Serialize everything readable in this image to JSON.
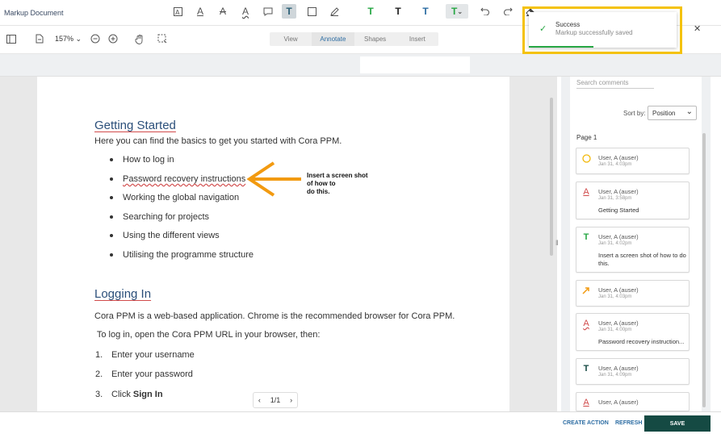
{
  "app": {
    "title": "Markup Document"
  },
  "toolbar": {
    "zoom": "157%",
    "modes": [
      "View",
      "Annotate",
      "Shapes",
      "Insert"
    ],
    "active_mode": "Annotate"
  },
  "document": {
    "heading1": "Getting Started",
    "intro": "Here you can find the basics to get you started with Cora PPM.",
    "bullets": [
      "How to log in",
      "Password recovery instructions",
      "Working the global navigation",
      "Searching for projects",
      "Using the different views",
      "Utilising the programme structure"
    ],
    "note": "Insert a screen shot of how to do this.",
    "note_lines": [
      "Insert a screen shot",
      "of how to",
      "do this."
    ],
    "heading2": "Logging In",
    "para1": "Cora PPM is a web-based application. Chrome is the recommended browser for Cora PPM.",
    "para2": " To log in, open the Cora PPM URL in your browser, then:",
    "steps": [
      {
        "num": "1.",
        "text": "Enter your username"
      },
      {
        "num": "2.",
        "text": "Enter your password"
      },
      {
        "num": "3.",
        "prefix": "Click ",
        "bold": "Sign In"
      }
    ],
    "pager": "1/1"
  },
  "comments": {
    "search_placeholder": "Search comments",
    "sort_label": "Sort by:",
    "sort_value": "Position",
    "page_label": "Page 1",
    "items": [
      {
        "user": "User, A (auser)",
        "date": "Jan 31, 4:03pm",
        "body": "",
        "icon": "circle-icon"
      },
      {
        "user": "User, A (auser)",
        "date": "Jan 31, 3:58pm",
        "body": "Getting Started",
        "icon": "underline-icon"
      },
      {
        "user": "User, A (auser)",
        "date": "Jan 31, 4:02pm",
        "body": "Insert a screen shot of how to do this.",
        "icon": "text-icon"
      },
      {
        "user": "User, A (auser)",
        "date": "Jan 31, 4:03pm",
        "body": "",
        "icon": "arrow-icon"
      },
      {
        "user": "User, A (auser)",
        "date": "Jan 31, 4:00pm",
        "body": "Password recovery instruction...",
        "icon": "squiggly-icon"
      },
      {
        "user": "User, A (auser)",
        "date": "Jan 31, 4:09pm",
        "body": "",
        "icon": "text-icon"
      },
      {
        "user": "User, A (auser)",
        "date": "",
        "body": "",
        "icon": "underline-icon"
      }
    ]
  },
  "footer": {
    "create_action": "CREATE ACTION",
    "refresh": "REFRESH",
    "save": "SAVE"
  },
  "toast": {
    "title": "Success",
    "message": "Markup successfully saved"
  },
  "colors": {
    "accent": "#2d6da3",
    "save": "#154a43",
    "success": "#27a744",
    "highlight": "#f4c20d",
    "arrow": "#f29a10"
  }
}
